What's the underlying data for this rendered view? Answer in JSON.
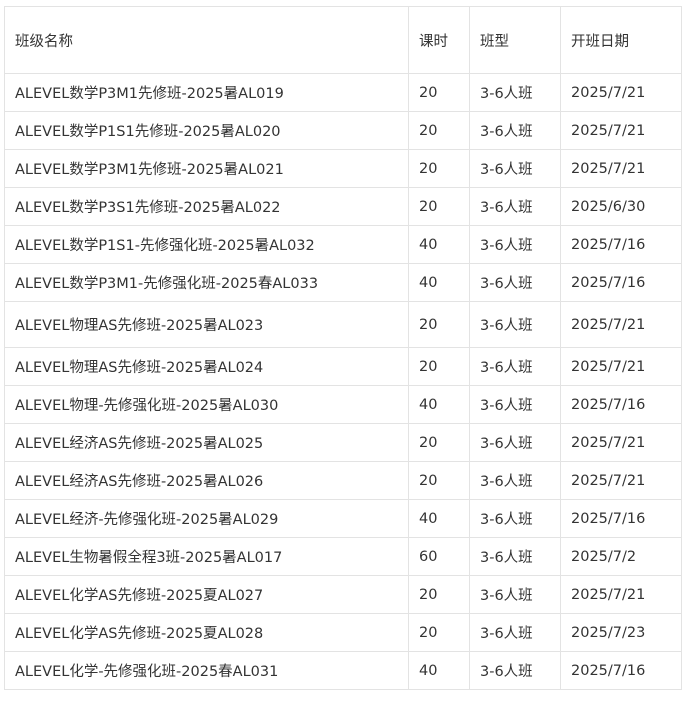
{
  "table": {
    "headers": [
      "班级名称",
      "课时",
      "班型",
      "开班日期"
    ],
    "rows": [
      [
        "ALEVEL数学P3M1先修班-2025暑AL019",
        "20",
        "3-6人班",
        "2025/7/21"
      ],
      [
        "ALEVEL数学P1S1先修班-2025暑AL020",
        "20",
        "3-6人班",
        "2025/7/21"
      ],
      [
        "ALEVEL数学P3M1先修班-2025暑AL021",
        "20",
        "3-6人班",
        "2025/7/21"
      ],
      [
        "ALEVEL数学P3S1先修班-2025暑AL022",
        "20",
        "3-6人班",
        "2025/6/30"
      ],
      [
        "ALEVEL数学P1S1-先修强化班-2025暑AL032",
        "40",
        "3-6人班",
        "2025/7/16"
      ],
      [
        "ALEVEL数学P3M1-先修强化班-2025春AL033",
        "40",
        "3-6人班",
        "2025/7/16"
      ],
      [
        "ALEVEL物理AS先修班-2025暑AL023",
        "20",
        "3-6人班",
        "2025/7/21"
      ],
      [
        "ALEVEL物理AS先修班-2025暑AL024",
        "20",
        "3-6人班",
        "2025/7/21"
      ],
      [
        "ALEVEL物理-先修强化班-2025暑AL030",
        "40",
        "3-6人班",
        "2025/7/16"
      ],
      [
        "ALEVEL经济AS先修班-2025暑AL025",
        "20",
        "3-6人班",
        "2025/7/21"
      ],
      [
        "ALEVEL经济AS先修班-2025暑AL026",
        "20",
        "3-6人班",
        "2025/7/21"
      ],
      [
        "ALEVEL经济-先修强化班-2025暑AL029",
        "40",
        "3-6人班",
        "2025/7/16"
      ],
      [
        "ALEVEL生物暑假全程3班-2025暑AL017",
        "60",
        "3-6人班",
        "2025/7/2"
      ],
      [
        "ALEVEL化学AS先修班-2025夏AL027",
        "20",
        "3-6人班",
        "2025/7/21"
      ],
      [
        "ALEVEL化学AS先修班-2025夏AL028",
        "20",
        "3-6人班",
        "2025/7/23"
      ],
      [
        "ALEVEL化学-先修强化班-2025春AL031",
        "40",
        "3-6人班",
        "2025/7/16"
      ]
    ]
  }
}
